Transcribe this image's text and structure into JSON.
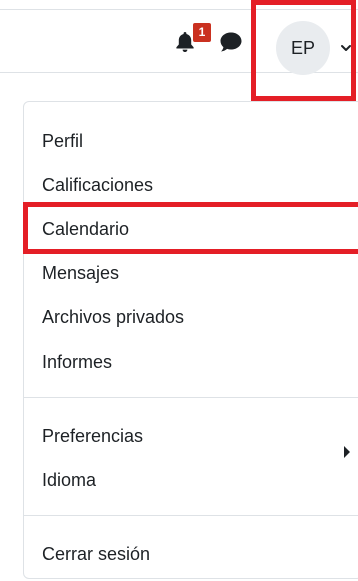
{
  "header": {
    "notifications": {
      "icon": "bell-icon",
      "count": "1",
      "badge_color": "#ca3120"
    },
    "messages": {
      "icon": "chat-bubble-icon"
    },
    "user": {
      "initials": "EP",
      "toggle_icon": "chevron-down-icon"
    }
  },
  "user_menu": {
    "items": [
      {
        "label": "Perfil"
      },
      {
        "label": "Calificaciones"
      },
      {
        "label": "Calendario",
        "highlighted": true
      },
      {
        "label": "Mensajes"
      },
      {
        "label": "Archivos privados"
      },
      {
        "label": "Informes"
      },
      {
        "label": "Preferencias"
      },
      {
        "label": "Idioma",
        "has_submenu": true,
        "submenu_icon": "caret-right-icon"
      },
      {
        "label": "Cerrar sesión"
      }
    ]
  },
  "colors": {
    "highlight_border": "#e41e26",
    "avatar_bg": "#e9ecef",
    "divider": "#dee2e6",
    "text": "#1d2125"
  }
}
